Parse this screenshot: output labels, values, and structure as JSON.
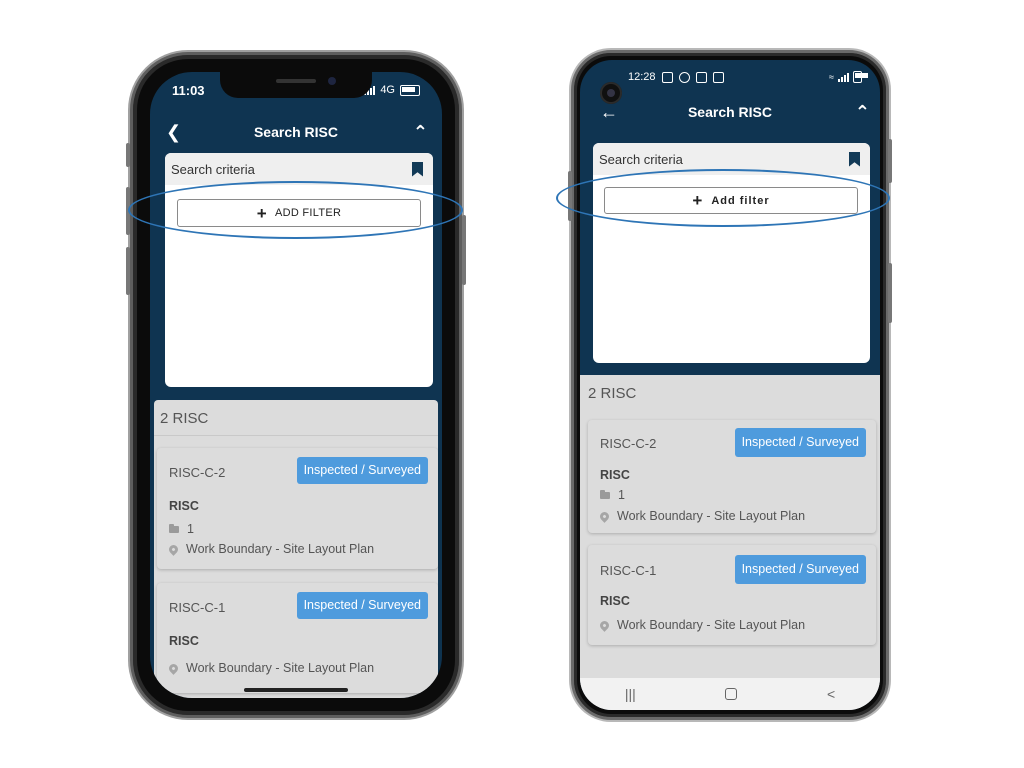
{
  "colors": {
    "header_bg": "#0f3451",
    "badge_bg": "#4e9bdd",
    "highlight": "#2e75b6"
  },
  "iphone": {
    "time": "11:03",
    "network": "4G",
    "title": "Search RISC",
    "back_icon": "chevron-left-icon",
    "collapse_icon": "chevron-up-icon",
    "criteria_label": "Search criteria",
    "add_filter_label": "ADD FILTER",
    "results_count": "2 RISC",
    "cards": [
      {
        "id": "RISC-C-2",
        "status": "Inspected / Surveyed",
        "type": "RISC",
        "folder_count": "1",
        "location": "Work Boundary - Site Layout Plan"
      },
      {
        "id": "RISC-C-1",
        "status": "Inspected / Surveyed",
        "type": "RISC",
        "location": "Work Boundary - Site Layout Plan"
      }
    ]
  },
  "android": {
    "time": "12:28",
    "title": "Search RISC",
    "back_icon": "arrow-left-icon",
    "collapse_icon": "chevron-up-icon",
    "criteria_label": "Search criteria",
    "add_filter_label": "Add filter",
    "results_count": "2 RISC",
    "cards": [
      {
        "id": "RISC-C-2",
        "status": "Inspected / Surveyed",
        "type": "RISC",
        "folder_count": "1",
        "location": "Work Boundary - Site Layout Plan"
      },
      {
        "id": "RISC-C-1",
        "status": "Inspected / Surveyed",
        "type": "RISC",
        "location": "Work Boundary - Site Layout Plan"
      }
    ],
    "nav": {
      "recents": "|||",
      "back": "<"
    }
  }
}
